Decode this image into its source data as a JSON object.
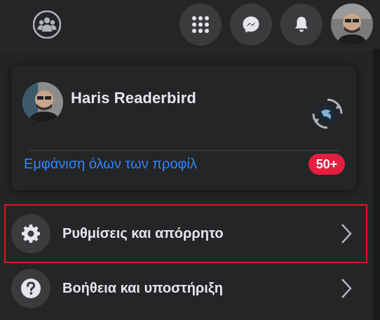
{
  "topbar": {
    "groups_icon": "groups-icon",
    "menu_icon": "grid-menu-icon",
    "messenger_icon": "messenger-icon",
    "notifications_icon": "bell-icon",
    "account_avatar": "account-avatar"
  },
  "profile": {
    "name": "Haris Readerbird",
    "see_all_profiles": "Εμφάνιση όλων των προφίλ",
    "badge": "50+"
  },
  "menu": {
    "items": [
      {
        "label": "Ρυθμίσεις και απόρρητο",
        "icon": "gear-icon"
      },
      {
        "label": "Βοήθεια και υποστήριξη",
        "icon": "question-icon"
      }
    ]
  },
  "colors": {
    "link": "#2d88ff",
    "badge": "#e41e3f",
    "highlight": "#e0141f"
  }
}
